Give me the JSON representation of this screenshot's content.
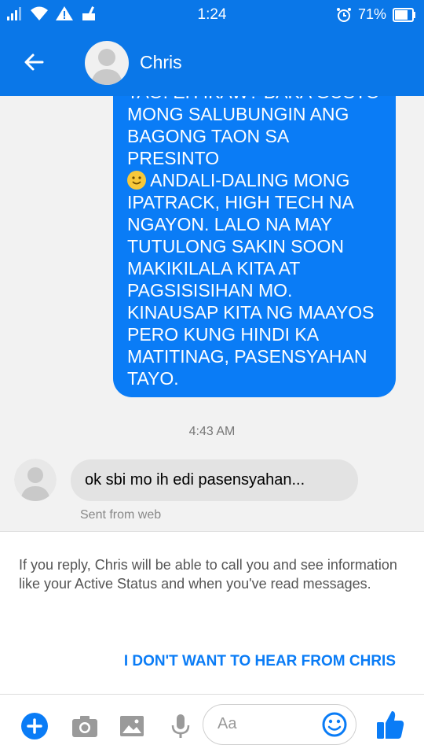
{
  "status_bar": {
    "time": "1:24",
    "battery": "71%"
  },
  "header": {
    "title": "Chris"
  },
  "messages": {
    "outgoing_text_1": "TAO. EH IKAW? BAKA GUSTO\nMONG SALUBUNGIN ANG\nBAGONG TAON SA PRESINTO\n",
    "outgoing_text_2": " ANDALI-DALING MONG\nIPATRACK, HIGH TECH NA\nNGAYON. LALO NA MAY\nTUTULONG SAKIN SOON\nMAKIKILALA KITA AT\nPAGSISISIHAN MO.\nKINAUSAP KITA NG MAAYOS\nPERO KUNG HINDI KA\nMATITINAG, PASENSYAHAN\nTAYO.",
    "timestamp": "4:43 AM",
    "incoming_text": "ok sbi mo ih edi pasensyahan...",
    "incoming_meta": "Sent from web"
  },
  "notice": {
    "text": "If you reply, Chris will be able to call you and see information like your Active Status and when you've read messages.",
    "action_label": "I DON'T WANT TO HEAR FROM CHRIS"
  },
  "composer": {
    "placeholder": "Aa"
  },
  "icons": {
    "back": "back-arrow-icon",
    "plus": "plus-icon",
    "camera": "camera-icon",
    "gallery": "gallery-icon",
    "mic": "microphone-icon",
    "emoji": "emoji-icon",
    "like": "thumbs-up-icon"
  },
  "colors": {
    "accent": "#0a77e8",
    "bubble_out": "#0a7cf6",
    "bubble_in": "#e3e3e3"
  }
}
